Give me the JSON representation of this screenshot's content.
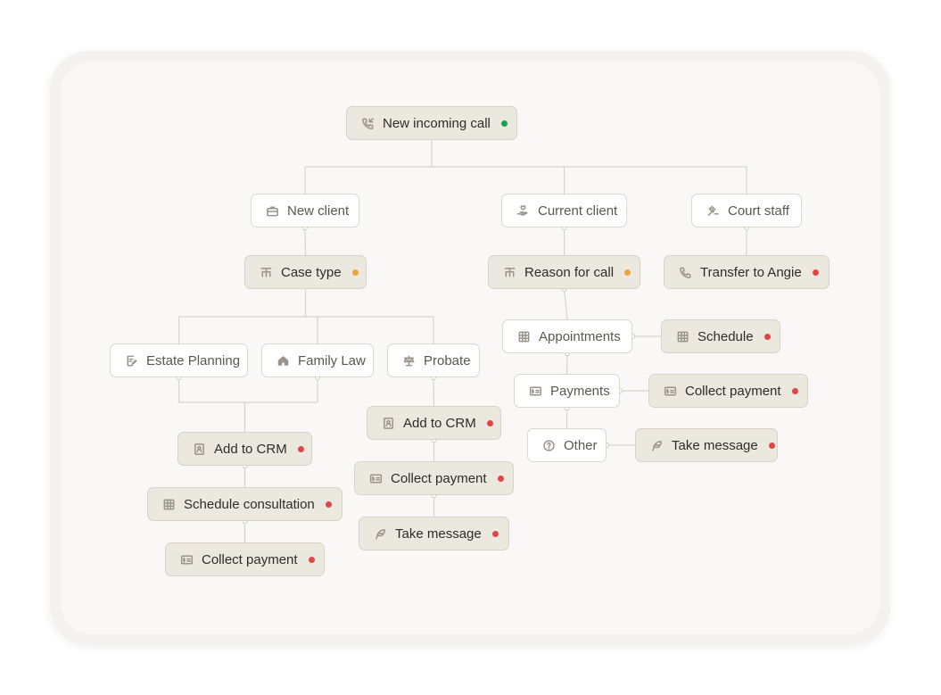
{
  "colors": {
    "status_green": "#1f9d55",
    "status_orange": "#eea23a",
    "status_red": "#e04646"
  },
  "nodes": {
    "new_incoming_call": {
      "label": "New incoming call",
      "icon": "phone-incoming-icon",
      "status": "green"
    },
    "new_client": {
      "label": "New client",
      "icon": "briefcase-icon"
    },
    "current_client": {
      "label": "Current client",
      "icon": "hand-heart-icon"
    },
    "court_staff": {
      "label": "Court staff",
      "icon": "gavel-icon"
    },
    "case_type": {
      "label": "Case type",
      "icon": "sitemap-icon",
      "status": "orange"
    },
    "reason_for_call": {
      "label": "Reason for call",
      "icon": "sitemap-icon",
      "status": "orange"
    },
    "transfer_to_angie": {
      "label": "Transfer to Angie",
      "icon": "phone-icon",
      "status": "red"
    },
    "estate_planning": {
      "label": "Estate Planning",
      "icon": "document-pen-icon"
    },
    "family_law": {
      "label": "Family Law",
      "icon": "home-icon"
    },
    "probate": {
      "label": "Probate",
      "icon": "scales-icon"
    },
    "appointments": {
      "label": "Appointments",
      "icon": "calendar-grid-icon"
    },
    "schedule": {
      "label": "Schedule",
      "icon": "calendar-grid-icon",
      "status": "red"
    },
    "payments": {
      "label": "Payments",
      "icon": "payment-card-icon"
    },
    "collect_payment_right": {
      "label": "Collect payment",
      "icon": "payment-card-icon",
      "status": "red"
    },
    "other": {
      "label": "Other",
      "icon": "question-circle-icon"
    },
    "take_message_right": {
      "label": "Take message",
      "icon": "feather-icon",
      "status": "red"
    },
    "add_to_crm_left": {
      "label": "Add to CRM",
      "icon": "contact-card-icon",
      "status": "red"
    },
    "schedule_consultation": {
      "label": "Schedule consultation",
      "icon": "calendar-grid-icon",
      "status": "red"
    },
    "collect_payment_left": {
      "label": "Collect payment",
      "icon": "payment-card-icon",
      "status": "red"
    },
    "add_to_crm_mid": {
      "label": "Add to CRM",
      "icon": "contact-card-icon",
      "status": "red"
    },
    "collect_payment_mid": {
      "label": "Collect payment",
      "icon": "payment-card-icon",
      "status": "red"
    },
    "take_message_mid": {
      "label": "Take message",
      "icon": "feather-icon",
      "status": "red"
    }
  }
}
